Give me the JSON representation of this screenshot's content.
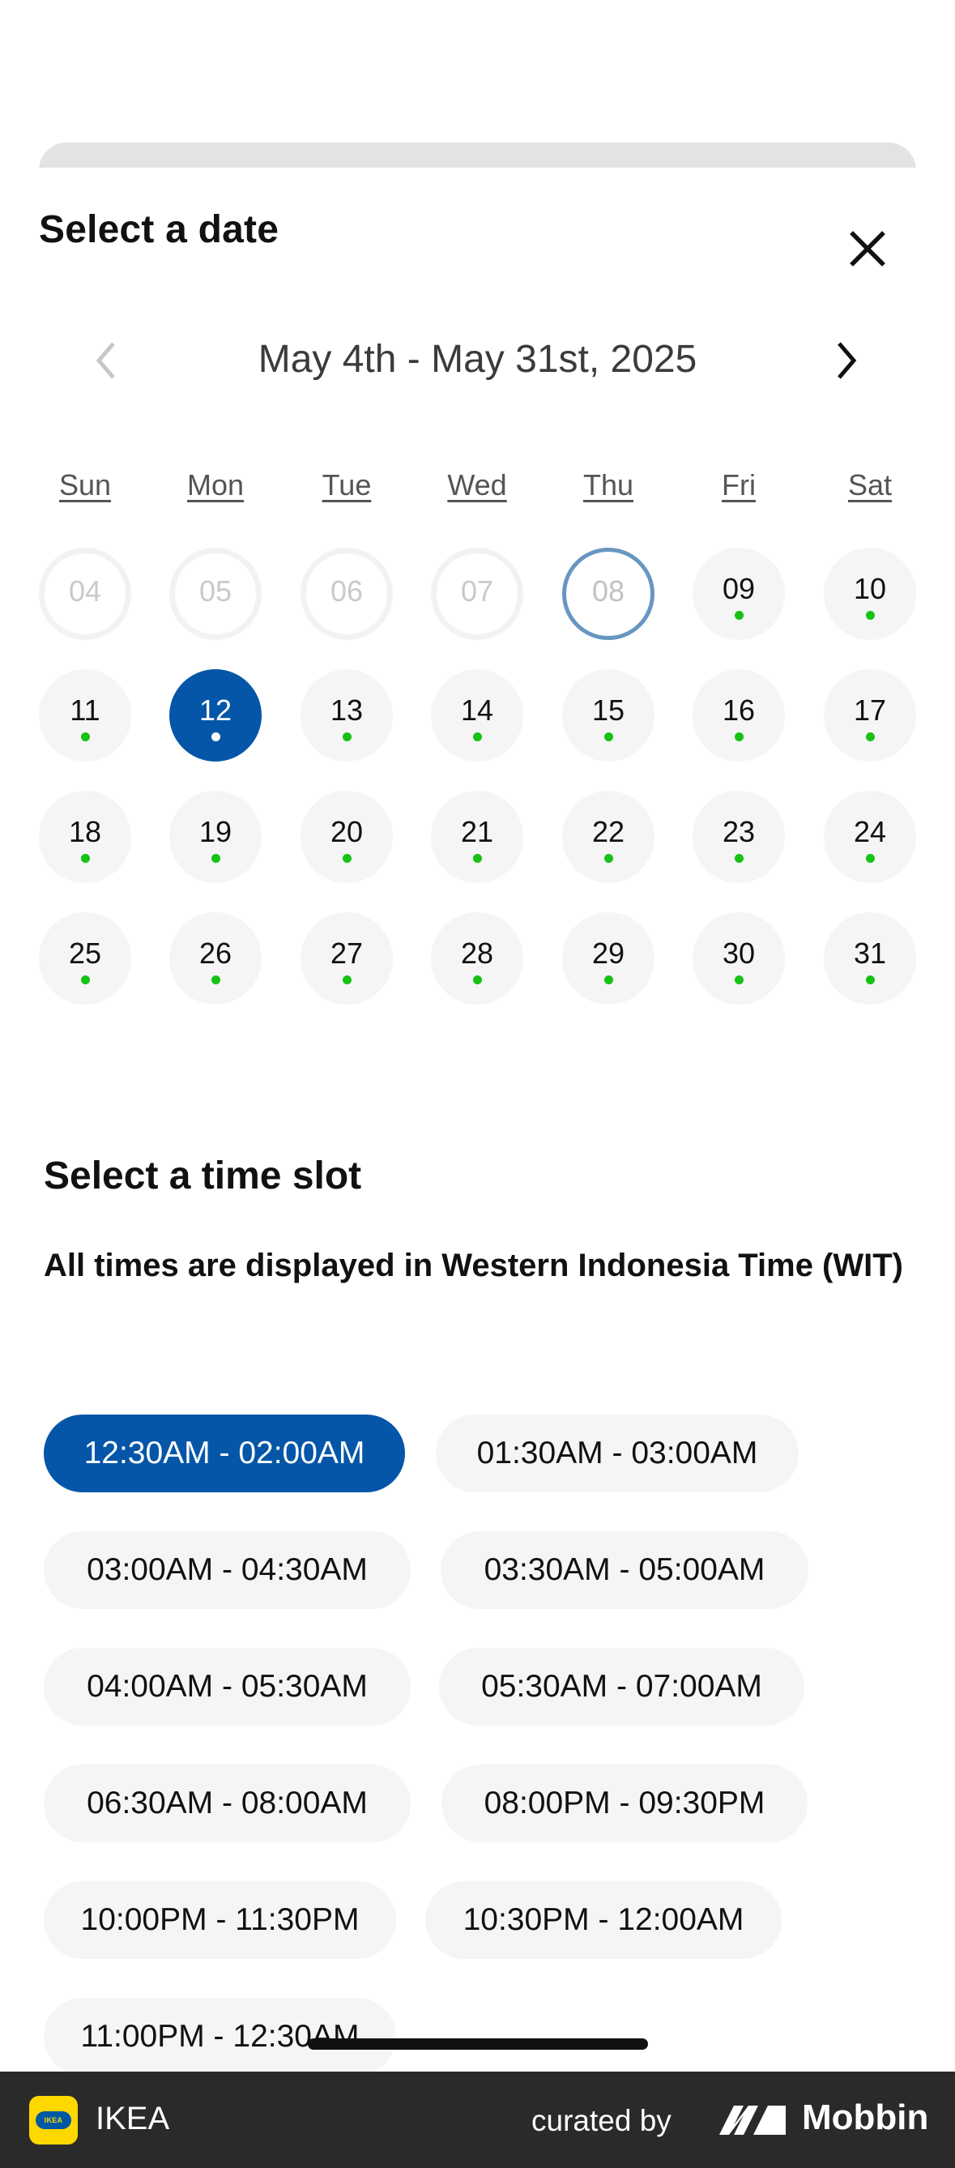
{
  "sheet": {
    "title": "Select a date",
    "range_label": "May 4th - May 31st, 2025"
  },
  "weekdays": [
    "Sun",
    "Mon",
    "Tue",
    "Wed",
    "Thu",
    "Fri",
    "Sat"
  ],
  "calendar": {
    "weeks": [
      [
        {
          "label": "04",
          "state": "disabled",
          "available": false
        },
        {
          "label": "05",
          "state": "disabled",
          "available": false
        },
        {
          "label": "06",
          "state": "disabled",
          "available": false
        },
        {
          "label": "07",
          "state": "disabled",
          "available": false
        },
        {
          "label": "08",
          "state": "today",
          "available": false
        },
        {
          "label": "09",
          "state": "normal",
          "available": true
        },
        {
          "label": "10",
          "state": "normal",
          "available": true
        }
      ],
      [
        {
          "label": "11",
          "state": "normal",
          "available": true
        },
        {
          "label": "12",
          "state": "selected",
          "available": true
        },
        {
          "label": "13",
          "state": "normal",
          "available": true
        },
        {
          "label": "14",
          "state": "normal",
          "available": true
        },
        {
          "label": "15",
          "state": "normal",
          "available": true
        },
        {
          "label": "16",
          "state": "normal",
          "available": true
        },
        {
          "label": "17",
          "state": "normal",
          "available": true
        }
      ],
      [
        {
          "label": "18",
          "state": "normal",
          "available": true
        },
        {
          "label": "19",
          "state": "normal",
          "available": true
        },
        {
          "label": "20",
          "state": "normal",
          "available": true
        },
        {
          "label": "21",
          "state": "normal",
          "available": true
        },
        {
          "label": "22",
          "state": "normal",
          "available": true
        },
        {
          "label": "23",
          "state": "normal",
          "available": true
        },
        {
          "label": "24",
          "state": "normal",
          "available": true
        }
      ],
      [
        {
          "label": "25",
          "state": "normal",
          "available": true
        },
        {
          "label": "26",
          "state": "normal",
          "available": true
        },
        {
          "label": "27",
          "state": "normal",
          "available": true
        },
        {
          "label": "28",
          "state": "normal",
          "available": true
        },
        {
          "label": "29",
          "state": "normal",
          "available": true
        },
        {
          "label": "30",
          "state": "normal",
          "available": true
        },
        {
          "label": "31",
          "state": "normal",
          "available": true
        }
      ]
    ]
  },
  "time": {
    "title": "Select a time slot",
    "timezone_note": "All times are displayed in Western Indonesia Time (WIT)",
    "slots": [
      {
        "label": "12:30AM - 02:00AM",
        "selected": true
      },
      {
        "label": "01:30AM - 03:00AM",
        "selected": false
      },
      {
        "label": "03:00AM - 04:30AM",
        "selected": false
      },
      {
        "label": "03:30AM - 05:00AM",
        "selected": false
      },
      {
        "label": "04:00AM - 05:30AM",
        "selected": false
      },
      {
        "label": "05:30AM - 07:00AM",
        "selected": false
      },
      {
        "label": "06:30AM - 08:00AM",
        "selected": false
      },
      {
        "label": "08:00PM - 09:30PM",
        "selected": false
      },
      {
        "label": "10:00PM - 11:30PM",
        "selected": false
      },
      {
        "label": "10:30PM - 12:00AM",
        "selected": false
      },
      {
        "label": "11:00PM - 12:30AM",
        "selected": false
      }
    ]
  },
  "icons": {
    "close": "close-icon",
    "prev": "chevron-left-icon",
    "next": "chevron-right-icon"
  },
  "colors": {
    "accent": "#0556a8",
    "available_dot": "#15c215",
    "today_ring": "#6896c2",
    "brand_yellow": "#ffd800",
    "brand_blue": "#0058a3"
  },
  "footer": {
    "app_name": "IKEA",
    "logo_text": "IKEA",
    "curated_by": "curated by",
    "brand": "Mobbin"
  }
}
